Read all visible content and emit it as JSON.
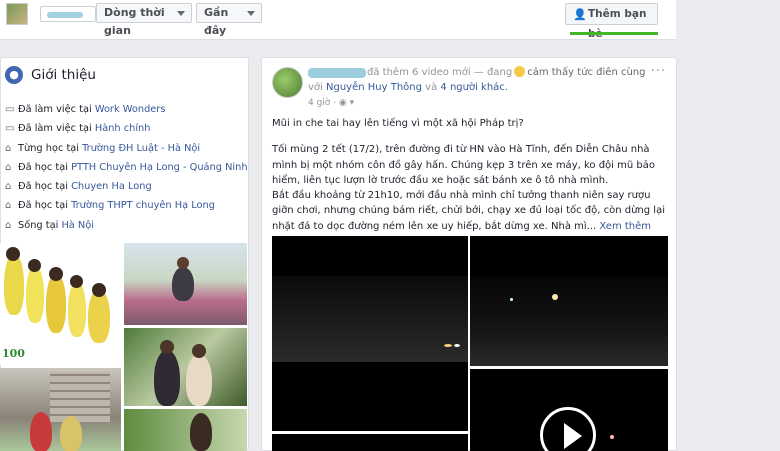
{
  "topbar": {
    "timeline_label": "Dòng thời gian",
    "recent_label": "Gần đây",
    "add_friend_label": "Thêm bạn bè",
    "add_friend_icon": "add-friend-icon"
  },
  "intro": {
    "title": "Giới thiệu",
    "items": [
      {
        "icon": "briefcase-icon",
        "prefix": "Đã làm việc tại ",
        "link": "Work Wonders"
      },
      {
        "icon": "briefcase-icon",
        "prefix": "Đã làm việc tại ",
        "link": "Hành chính"
      },
      {
        "icon": "graduation-cap-icon",
        "prefix": "Từng học tại ",
        "link": "Trường ĐH Luật - Hà Nội"
      },
      {
        "icon": "graduation-cap-icon",
        "prefix": "Đã học tại ",
        "link": "PTTH Chuyên Hạ Long - Quảng Ninh"
      },
      {
        "icon": "graduation-cap-icon",
        "prefix": "Đã học tại ",
        "link": "Chuyen Ha Long"
      },
      {
        "icon": "graduation-cap-icon",
        "prefix": "Đã học tại ",
        "link": "Trường THPT chuyên Hạ Long"
      },
      {
        "icon": "home-icon",
        "prefix": "Sống tại ",
        "link": "Hà Nội"
      }
    ],
    "photo_logo": "100"
  },
  "post": {
    "action": "đã thêm 6 video mới",
    "feeling_prefix": "— đang",
    "feeling": "cảm thấy tức điên cùng",
    "with_prefix": "với",
    "tagged_person": "Nguyễn Huy Thông",
    "and_label": "và",
    "others": "4 người khác.",
    "time": "4 giờ",
    "more_label": "···",
    "question": "Mũi in che tai hay lên tiếng vì một xã hội Pháp trị?",
    "paragraph1": "Tối mùng 2 tết (17/2), trên đường đi từ HN vào Hà Tĩnh, đến Diễn Châu nhà mình bị một nhóm côn đồ gây hấn. Chúng kẹp 3 trên xe máy, ko đội mũ bảo hiểm, liên tục lượn lờ trước đầu xe hoặc sát bánh xe ô tô nhà mình.",
    "paragraph2": "Bắt đầu khoảng từ 21h10, mới đầu nhà mình chỉ tưởng thanh niên say rượu giỡn chơi, nhưng chúng bám riết, chửi bới, chạy xe đủ loại tốc độ, còn dừng lại nhặt đá to dọc đường ném lên xe uy hiếp, bắt dừng xe. Nhà mì...",
    "see_more": "Xem thêm"
  }
}
